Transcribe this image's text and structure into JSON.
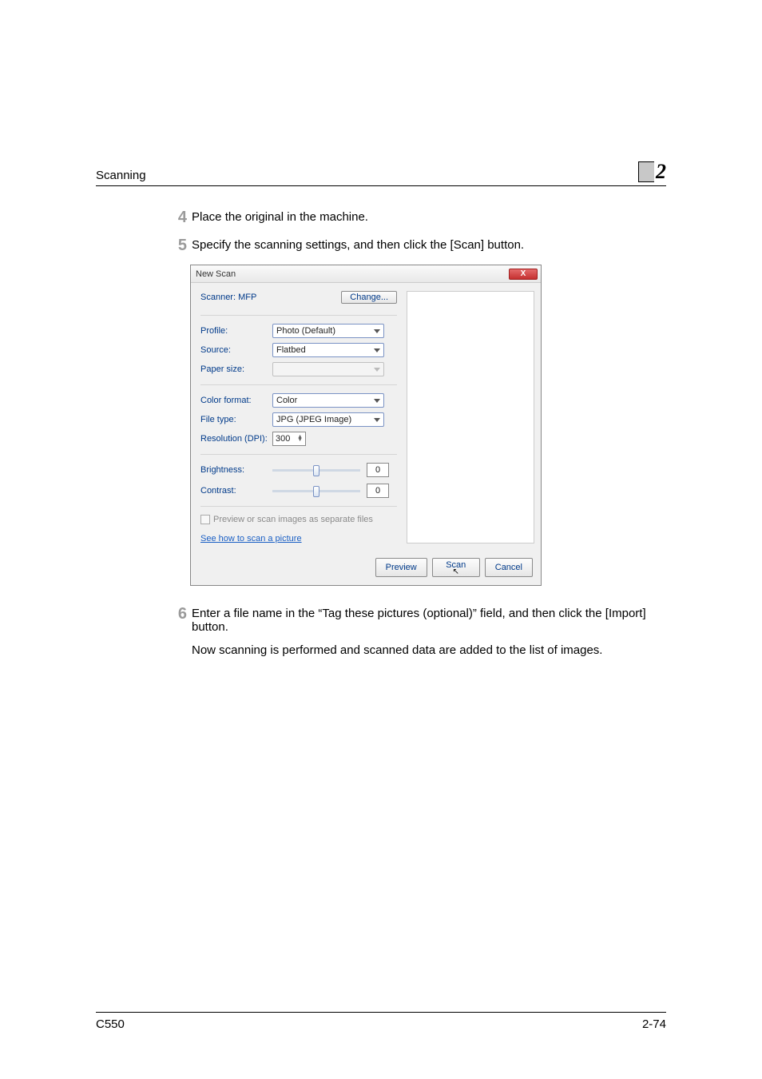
{
  "header": {
    "section": "Scanning",
    "chapter": "2"
  },
  "steps": {
    "s4": {
      "n": "4",
      "text": "Place the original in the machine."
    },
    "s5": {
      "n": "5",
      "text": "Specify the scanning settings, and then click the [Scan] button."
    },
    "s6": {
      "n": "6",
      "text": "Enter a file name in the “Tag these pictures (optional)” field, and then click the [Import] button."
    }
  },
  "followup": "Now scanning is performed and scanned data are added to the list of images.",
  "dialog": {
    "title": "New Scan",
    "close_glyph": "X",
    "scanner_label": "Scanner: MFP",
    "change_btn": "Change...",
    "labels": {
      "profile": "Profile:",
      "source": "Source:",
      "paper": "Paper size:",
      "colorfmt": "Color format:",
      "filetype": "File type:",
      "res": "Resolution (DPI):",
      "brightness": "Brightness:",
      "contrast": "Contrast:"
    },
    "values": {
      "profile": "Photo (Default)",
      "source": "Flatbed",
      "paper": "",
      "colorfmt": "Color",
      "filetype": "JPG (JPEG Image)",
      "res": "300",
      "brightness": "0",
      "contrast": "0"
    },
    "checkbox": "Preview or scan images as separate files",
    "link": "See how to scan a picture",
    "buttons": {
      "preview": "Preview",
      "scan": "Scan",
      "cancel": "Cancel"
    }
  },
  "footer": {
    "left": "C550",
    "right": "2-74"
  }
}
